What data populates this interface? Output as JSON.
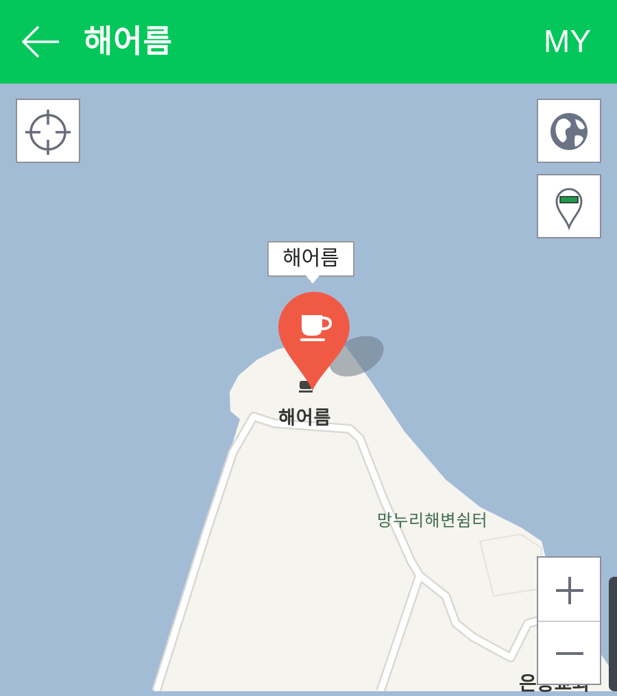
{
  "header": {
    "title": "해어름",
    "my_label": "MY",
    "bg_color": "#03c75a"
  },
  "map": {
    "water_color": "#a3bcd6",
    "land_color": "#f5f4ee",
    "road_color": "#ffffff",
    "marker_color": "#f05a45",
    "callout_label": "해어름",
    "poi_label": "해어름",
    "place_label": "망누리해변쉼터",
    "place_label_partial": "은총교회"
  },
  "controls": {
    "locate_icon": "crosshair-icon",
    "globe_icon": "globe-icon",
    "pin_icon": "pin-icon",
    "zoom_in": "+",
    "zoom_out": "−"
  }
}
